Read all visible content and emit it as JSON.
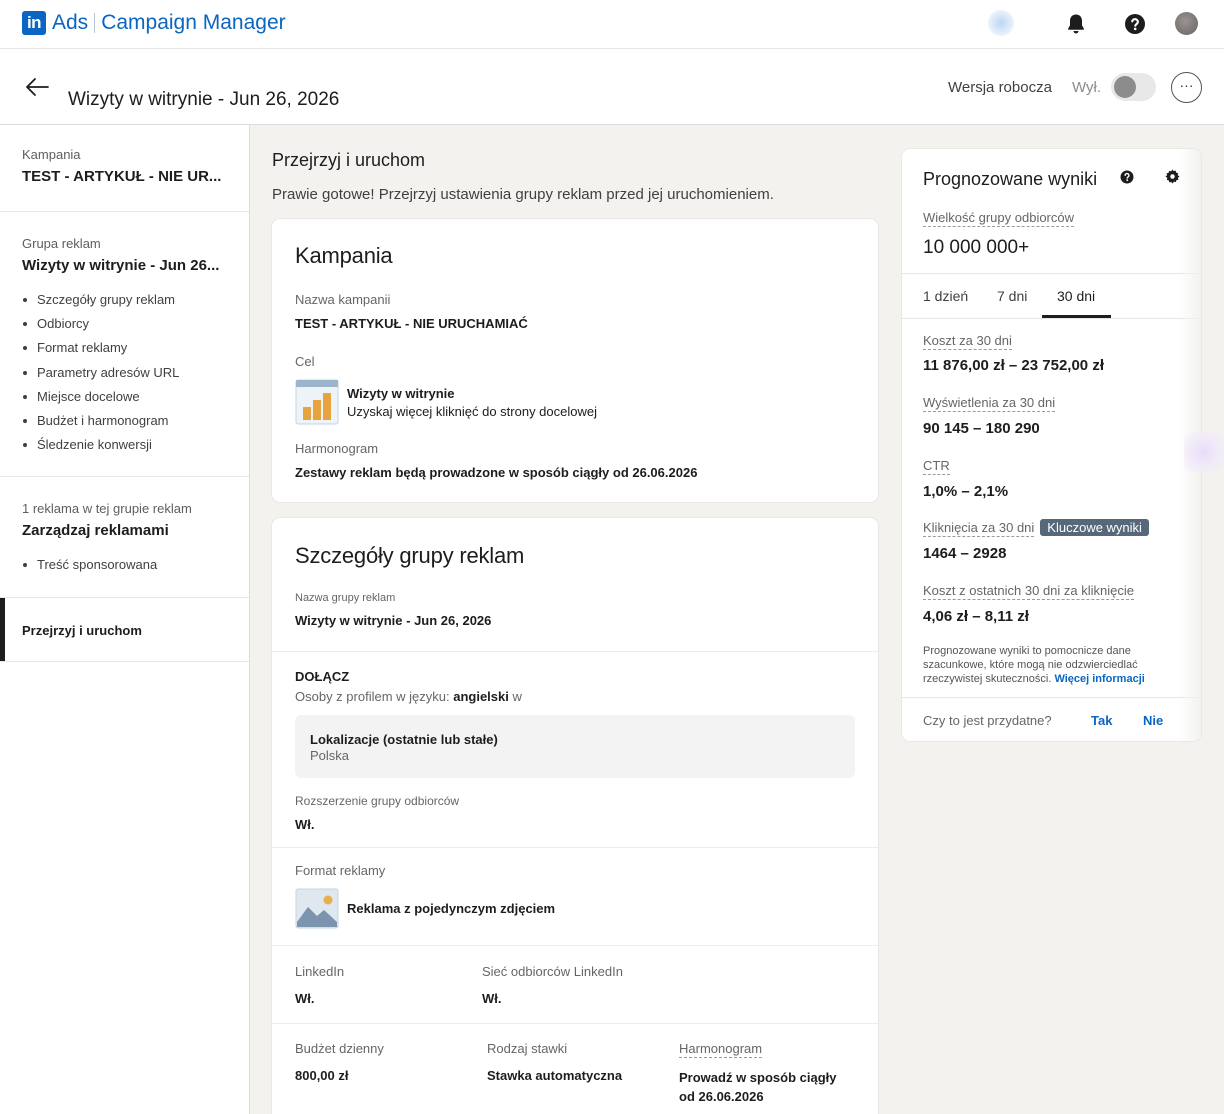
{
  "nav": {
    "brand_logo": "in",
    "brand_ads": "Ads",
    "brand_app": "Campaign Manager",
    "icons": [
      "bell-icon",
      "help-icon",
      "avatar"
    ]
  },
  "header": {
    "title": "Wizyty w witrynie - Jun 26, 2026",
    "status": "Wersja robocza",
    "toggle_label": "Wył.",
    "more": "···"
  },
  "sidebar": {
    "campaign_label": "Kampania",
    "campaign_name": "TEST - ARTYKUŁ - NIE UR...",
    "group_label": "Grupa reklam",
    "group_name": "Wizyty w witrynie - Jun 26...",
    "group_items": [
      "Szczegóły grupy reklam",
      "Odbiorcy",
      "Format reklamy",
      "Parametry adresów URL",
      "Miejsce docelowe",
      "Budżet i harmonogram",
      "Śledzenie konwersji"
    ],
    "ads_label": "1 reklama w tej grupie reklam",
    "ads_manage": "Zarządzaj reklamami",
    "ads_items": [
      "Treść sponsorowana"
    ],
    "active_item": "Przejrzyj i uruchom"
  },
  "main": {
    "title": "Przejrzyj i uruchom",
    "subtitle": "Prawie gotowe! Przejrzyj ustawienia grupy reklam przed jej uruchomieniem.",
    "campaign_card": {
      "heading": "Kampania",
      "name_label": "Nazwa kampanii",
      "name_value": "TEST - ARTYKUŁ - NIE URUCHAMIAĆ",
      "goal_label": "Cel",
      "goal_title": "Wizyty w witrynie",
      "goal_desc": "Uzyskaj więcej kliknięć do strony docelowej",
      "schedule_label": "Harmonogram",
      "schedule_value": "Zestawy reklam będą prowadzone w sposób ciągły od 26.06.2026"
    },
    "group_card": {
      "heading": "Szczegóły grupy reklam",
      "name_label": "Nazwa grupy reklam",
      "name_value": "Wizyty w witrynie - Jun 26, 2026",
      "include_label": "DOŁĄCZ",
      "lang_prefix": "Osoby z profilem w języku: ",
      "lang_value": "angielski",
      "lang_suffix": " w",
      "location_title": "Lokalizacje (ostatnie lub stałe)",
      "location_value": "Polska",
      "expansion_label": "Rozszerzenie grupy odbiorców",
      "expansion_value": "Wł.",
      "format_label": "Format reklamy",
      "format_value": "Reklama z pojedynczym zdjęciem",
      "linkedin_label": "LinkedIn",
      "linkedin_value": "Wł.",
      "network_label": "Sieć odbiorców LinkedIn",
      "network_value": "Wł.",
      "budget_label": "Budżet dzienny",
      "budget_value": "800,00 zł",
      "bid_label": "Rodzaj stawki",
      "bid_value": "Stawka automatyczna",
      "schedule_label": "Harmonogram",
      "schedule_value_1": "Prowadź w sposób ciągły",
      "schedule_value_2": "od 26.06.2026"
    }
  },
  "forecast": {
    "title": "Prognozowane wyniki",
    "audience_label": "Wielkość grupy odbiorców",
    "audience_value": "10 000 000+",
    "tabs": [
      "1 dzień",
      "7 dni",
      "30 dni"
    ],
    "active_tab": "30 dni",
    "cost_label": "Koszt za 30 dni",
    "cost_value": "11 876,00 zł – 23 752,00 zł",
    "impressions_label": "Wyświetlenia za 30 dni",
    "impressions_value": "90 145 – 180 290",
    "ctr_label": "CTR",
    "ctr_value": "1,0% – 2,1%",
    "clicks_label": "Kliknięcia za 30 dni",
    "clicks_badge": "Kluczowe wyniki",
    "clicks_value": "1464 – 2928",
    "cpc_label": "Koszt z ostatnich 30 dni za kliknięcie",
    "cpc_value": "4,06 zł – 8,11 zł",
    "disclaimer": "Prognozowane wyniki to pomocnicze dane szacunkowe, które mogą nie odzwierciedlać rzeczywistej skuteczności.",
    "more_info": "Więcej informacji",
    "helpful_q": "Czy to jest przydatne?",
    "yes": "Tak",
    "no": "Nie"
  },
  "colors": {
    "brand": "#0a66c2",
    "badge_bg": "#56687a",
    "active_nav": "#1d1d1d"
  }
}
